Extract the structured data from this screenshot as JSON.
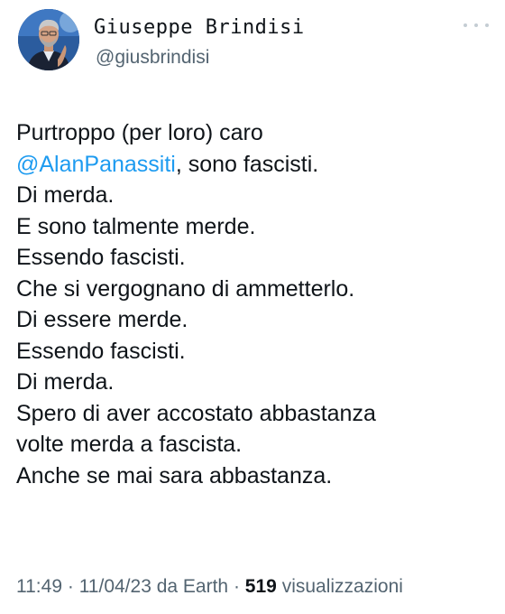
{
  "author": {
    "name": "Giuseppe Brindisi",
    "handle": "@giusbrindisi"
  },
  "tweet": {
    "line1": "Purtroppo (per loro) caro",
    "mention": "@AlanPanassiti",
    "line2_rest": ", sono fascisti.",
    "lines": [
      "Di merda.",
      "E sono talmente merde.",
      "Essendo fascisti.",
      "Che si vergognano di ammetterlo.",
      "Di essere merde.",
      "Essendo fascisti.",
      "Di merda.",
      "Spero di aver accostato abbastanza",
      "volte merda a fascista.",
      "Anche se mai sara abbastanza."
    ]
  },
  "meta": {
    "time": "11:49",
    "sep1": "·",
    "date": "11/04/23",
    "source": "da Earth",
    "sep2": "·",
    "views_count": "519",
    "views_label": "visualizzazioni"
  },
  "icons": {
    "more": "more-dots-icon"
  },
  "colors": {
    "text": "#0f1419",
    "secondary": "#536471",
    "link": "#1d9bf0"
  }
}
